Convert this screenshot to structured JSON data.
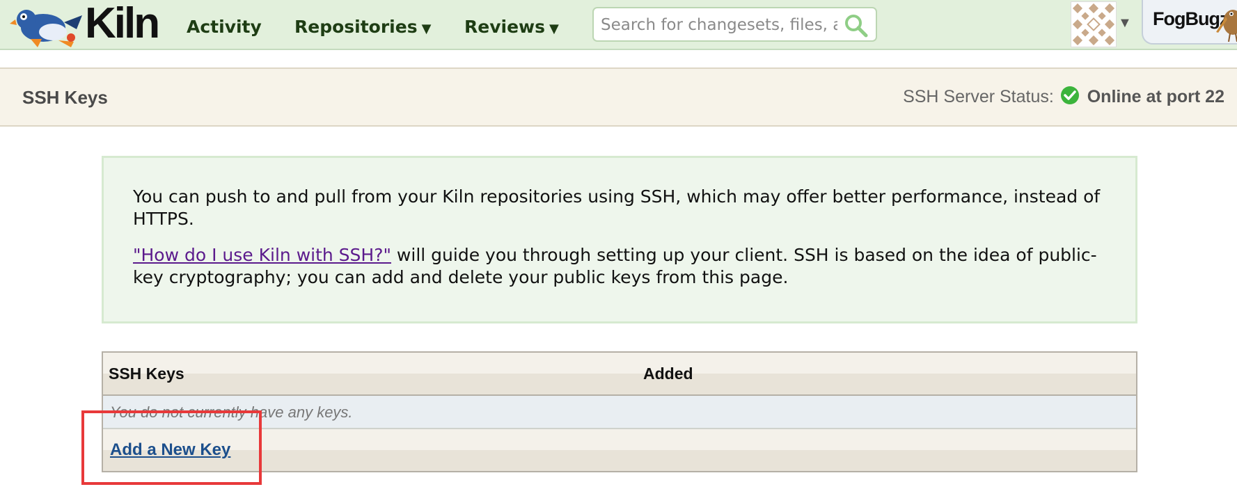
{
  "header": {
    "brand": "Kiln",
    "nav": [
      {
        "label": "Activity",
        "caret": ""
      },
      {
        "label": "Repositories",
        "caret": "▼"
      },
      {
        "label": "Reviews",
        "caret": "▼"
      }
    ],
    "search_placeholder": "Search for changesets, files, a",
    "fogbugz_label": "FogBugz",
    "icons": {
      "logo": "kiln-bird-logo",
      "search": "search-icon",
      "avatar": "user-avatar",
      "kiwi": "fogbugz-kiwi-logo"
    },
    "colors": {
      "nav_bg": "#e2f0dc",
      "nav_text": "#1e3d14"
    }
  },
  "subheader": {
    "title": "SSH Keys",
    "status_label": "SSH Server Status:",
    "status_value": "Online at port 22",
    "status_color": "#3cb43c"
  },
  "info": {
    "paragraph1": "You can push to and pull from your Kiln repositories using SSH, which may offer better performance, instead of HTTPS.",
    "link_text": "\"How do I use Kiln with SSH?\"",
    "paragraph2_rest": " will guide you through setting up your client. SSH is based on the idea of public-key cryptography; you can add and delete your public keys from this page."
  },
  "keys_table": {
    "columns": [
      "SSH Keys",
      "Added"
    ],
    "empty_message": "You do not currently have any keys.",
    "add_link": "Add a New Key"
  }
}
